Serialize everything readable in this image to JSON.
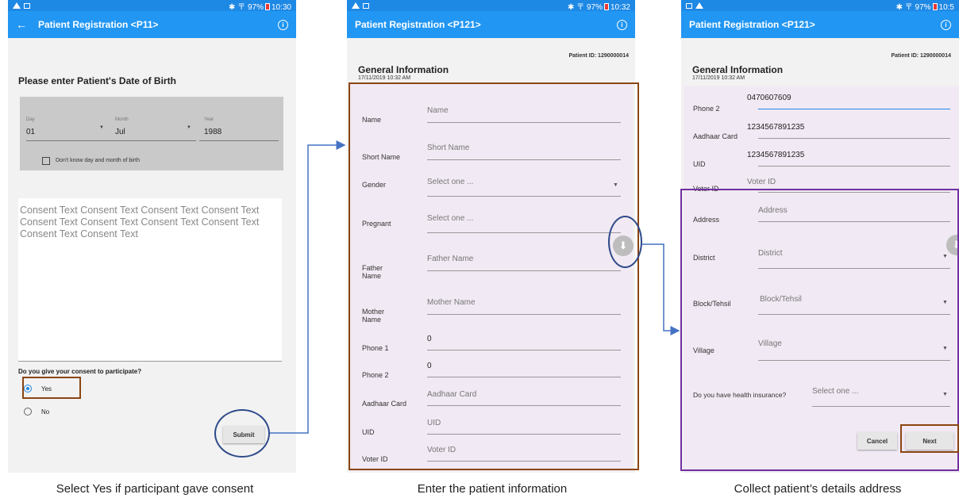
{
  "screen1": {
    "status": {
      "bt": "✱",
      "signal": "〒",
      "battery": "97%",
      "time": "10:30"
    },
    "appbar": {
      "title": "Patient Registration <P11>"
    },
    "heading": "Please enter Patient's Date of Birth",
    "dob": {
      "day_label": "Day",
      "day_value": "01",
      "month_label": "Month",
      "month_value": "Jul",
      "year_label": "Year",
      "year_value": "1988",
      "unknown_checkbox_label": "Don't know day and month of birth"
    },
    "consent_text": "Consent Text Consent Text Consent Text Consent Text Consent Text Consent Text Consent Text Consent Text Consent Text Consent Text",
    "consent_question": "Do you give your consent to participate?",
    "options": [
      "Yes",
      "No"
    ],
    "selected_option": "Yes",
    "submit_label": "Submit",
    "caption": "Select Yes if participant gave consent"
  },
  "screen2": {
    "status": {
      "bt": "✱",
      "signal": "〒",
      "battery": "97%",
      "time": "10:32"
    },
    "appbar": {
      "title": "Patient Registration <P121>"
    },
    "patient_id": "Patient ID: 1290000014",
    "section_title": "General Information",
    "section_date": "17/11/2019 10:32 AM",
    "fields": [
      {
        "label": "Name",
        "value": "Name"
      },
      {
        "label": "Short Name",
        "value": "Short Name"
      },
      {
        "label": "Gender",
        "value": "Select one ..."
      },
      {
        "label": "Pregnant",
        "value": "Select one ..."
      },
      {
        "label": "Father Name",
        "value": "Father Name"
      },
      {
        "label": "Mother Name",
        "value": "Mother Name"
      },
      {
        "label": "Phone 1",
        "value": "0"
      },
      {
        "label": "Phone 2",
        "value": "0"
      },
      {
        "label": "Aadhaar Card",
        "value": "Aadhaar Card"
      },
      {
        "label": "UID",
        "value": "UID"
      },
      {
        "label": "Voter ID",
        "value": "Voter ID"
      }
    ],
    "caption": "Enter the patient information"
  },
  "screen3": {
    "status": {
      "bt": "✱",
      "signal": "〒",
      "battery": "97%",
      "time": "10:5"
    },
    "appbar": {
      "title": "Patient Registration <P121>"
    },
    "patient_id": "Patient ID: 1290000014",
    "section_title": "General Information",
    "section_date": "17/11/2019 10:32 AM",
    "fields": [
      {
        "label": "Phone 2",
        "value": "0470607609"
      },
      {
        "label": "Aadhaar Card",
        "value": "1234567891235"
      },
      {
        "label": "UID",
        "value": "1234567891235"
      },
      {
        "label": "Voter ID",
        "value": "Voter ID"
      },
      {
        "label": "Address",
        "value": "Address"
      },
      {
        "label": "District",
        "value": "District"
      },
      {
        "label": "Block/Tehsil",
        "value": "Block/Tehsil"
      },
      {
        "label": "Village",
        "value": "Village"
      },
      {
        "label": "Do you have health insurance?",
        "value": "Select one ..."
      }
    ],
    "cancel_label": "Cancel",
    "next_label": "Next",
    "caption": "Collect patient’s details address"
  },
  "colors": {
    "primary": "#2196f3",
    "statusbar": "#1e88e5",
    "highlight_brown": "#8b4513",
    "highlight_purple": "#7030a0",
    "annotation_blue": "#4472c4"
  }
}
